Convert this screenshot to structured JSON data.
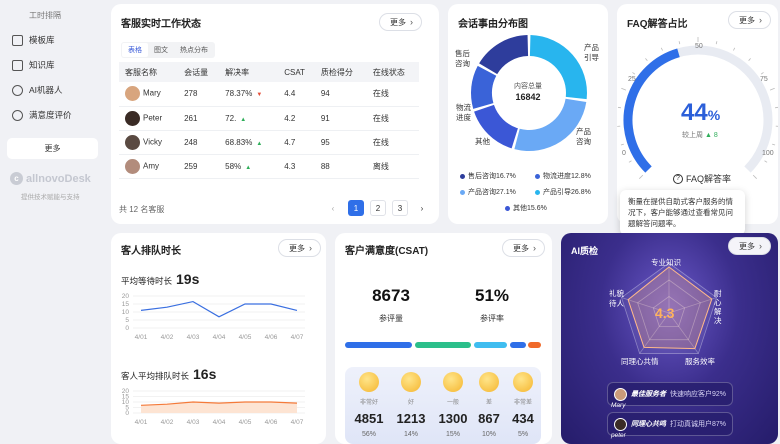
{
  "sidebar": {
    "title": "工时排隔",
    "items": [
      {
        "label": "模板库",
        "icon": "template-icon"
      },
      {
        "label": "知识库",
        "icon": "book-icon"
      },
      {
        "label": "AI机器人",
        "icon": "robot-icon"
      },
      {
        "label": "满意度评价",
        "icon": "smile-icon"
      }
    ],
    "more": "更多",
    "logo": "allnovoDesk",
    "caption": "提供技术赋能与支持"
  },
  "common": {
    "more": "更多"
  },
  "agents": {
    "title": "客服实时工作状态",
    "tabs": [
      "表格",
      "图文",
      "热点分布"
    ],
    "columns": [
      "客服名称",
      "会话量",
      "解决率",
      "CSAT",
      "质检得分",
      "在线状态"
    ],
    "rows": [
      {
        "name": "Mary",
        "sessions": "278",
        "rate": "78.37%",
        "trend": "down",
        "csat": "4.4",
        "qa": "94",
        "status": "在线"
      },
      {
        "name": "Peter",
        "sessions": "261",
        "rate": "72.",
        "trend": "up",
        "csat": "4.2",
        "qa": "91",
        "status": "在线"
      },
      {
        "name": "Vicky",
        "sessions": "248",
        "rate": "68.83%",
        "trend": "up",
        "csat": "4.7",
        "qa": "95",
        "status": "在线"
      },
      {
        "name": "Amy",
        "sessions": "259",
        "rate": "58%",
        "trend": "up",
        "csat": "4.3",
        "qa": "88",
        "status": "离线"
      }
    ],
    "footer": "共 12 名客服",
    "pages": [
      "1",
      "2",
      "3"
    ],
    "current_page": "1"
  },
  "topics": {
    "title": "会话事由分布图",
    "center_label": "内容总量",
    "center_value": "16842",
    "labels": {
      "after_sales": "售后\n咨询",
      "logistics": "物流\n进度",
      "other": "其他",
      "product_guide": "产品\n引导",
      "product_consult": "产品\n咨询"
    },
    "legend": [
      {
        "label": "售后咨询16.7%",
        "color": "#2e3d9c"
      },
      {
        "label": "物流进度12.8%",
        "color": "#3a63d8"
      },
      {
        "label": "产品咨询27.1%",
        "color": "#6aa9f5"
      },
      {
        "label": "产品引导26.8%",
        "color": "#28b5ee"
      },
      {
        "label": "其他15.6%",
        "color": "#3b57d6"
      }
    ]
  },
  "faq": {
    "title": "FAQ解答占比",
    "value": "44",
    "unit": "%",
    "compare_label": "较上周",
    "compare_value": "8",
    "ticks": [
      "0",
      "25",
      "50",
      "75",
      "100"
    ],
    "subtitle": "FAQ解答率",
    "tooltip": "衡量在提供自助式客户服务的情况下，客户能够通过查看常见问题解答问题率。"
  },
  "queue": {
    "title": "客人排队时长",
    "wait_label": "平均等待时长",
    "wait_value": "19s",
    "queue_label": "客人平均排队时长",
    "queue_value": "16s",
    "y_ticks": [
      "20",
      "15",
      "10",
      "5",
      "0"
    ],
    "x_ticks": [
      "4/01",
      "4/02",
      "4/03",
      "4/04",
      "4/05",
      "4/06",
      "4/07"
    ]
  },
  "csat": {
    "title": "客户满意度(CSAT)",
    "count": "8673",
    "count_label": "参评量",
    "rate": "51%",
    "rate_label": "参评率",
    "levels": [
      {
        "label": "非常好",
        "count": "4851",
        "pct": "56%"
      },
      {
        "label": "好",
        "count": "1213",
        "pct": "14%"
      },
      {
        "label": "一般",
        "count": "1300",
        "pct": "15%"
      },
      {
        "label": "差",
        "count": "867",
        "pct": "10%"
      },
      {
        "label": "非常差",
        "count": "434",
        "pct": "5%"
      }
    ]
  },
  "ai": {
    "title": "AI质检",
    "score": "4.3",
    "dims": {
      "knowledge": "专业知识",
      "politeness": "礼貌\n待人",
      "patience": "耐\n心\n解\n决",
      "empathy": "同理心共情",
      "efficiency": "服务效率"
    },
    "awards": [
      {
        "title": "最佳服务者",
        "desc": "快速响应客户92%",
        "name": "Mary"
      },
      {
        "title": "同理心共鸣",
        "desc": "打动真诚用户87%",
        "name": "peter"
      }
    ]
  },
  "chart_data": [
    {
      "type": "pie",
      "title": "会话事由分布图",
      "categories": [
        "售后咨询",
        "物流进度",
        "产品咨询",
        "产品引导",
        "其他"
      ],
      "values": [
        16.7,
        12.8,
        27.1,
        26.8,
        15.6
      ]
    },
    {
      "type": "line",
      "title": "平均等待时长",
      "x": [
        "4/01",
        "4/02",
        "4/03",
        "4/04",
        "4/05",
        "4/06",
        "4/07"
      ],
      "values": [
        11,
        13,
        16.5,
        7,
        15,
        15,
        11
      ],
      "ylim": [
        0,
        20
      ]
    },
    {
      "type": "area",
      "title": "客人平均排队时长",
      "x": [
        "4/01",
        "4/02",
        "4/03",
        "4/04",
        "4/05",
        "4/06",
        "4/07"
      ],
      "values": [
        7,
        8,
        10,
        9,
        10,
        10,
        9
      ],
      "ylim": [
        0,
        20
      ]
    }
  ]
}
